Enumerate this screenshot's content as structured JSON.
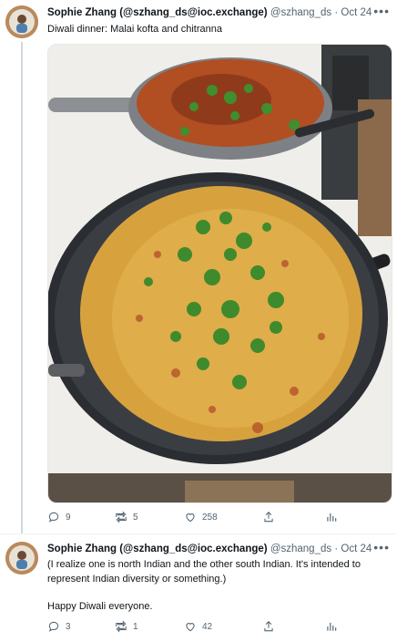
{
  "tweets": [
    {
      "author_name": "Sophie Zhang (@szhang_ds@ioc.exchange)",
      "handle": "@szhang_ds",
      "separator": "·",
      "date": "Oct 24",
      "text": "Diwali dinner: Malai kofta and chitranna",
      "photo": {
        "icon": "food-photo",
        "description_colors": [
          "#f0f0ec",
          "#2c2f33",
          "#d9a84a",
          "#3f8a2c",
          "#b5532a"
        ]
      },
      "stats": {
        "replies": "9",
        "retweets": "5",
        "likes": "258"
      }
    },
    {
      "author_name": "Sophie Zhang (@szhang_ds@ioc.exchange)",
      "handle": "@szhang_ds",
      "separator": "·",
      "date": "Oct 24",
      "text_line1": "(I realize one is north Indian and the other south Indian. It's intended to",
      "text_line2": "represent Indian diversity or something.)",
      "text_line3": "Happy Diwali everyone.",
      "stats": {
        "replies": "3",
        "retweets": "1",
        "likes": "42"
      }
    }
  ],
  "colors": {
    "text": "#0f1419",
    "muted": "#536471",
    "divider": "#eff3f4"
  },
  "icons": [
    "reply-icon",
    "retweet-icon",
    "like-icon",
    "share-icon",
    "analytics-icon",
    "more-icon"
  ]
}
